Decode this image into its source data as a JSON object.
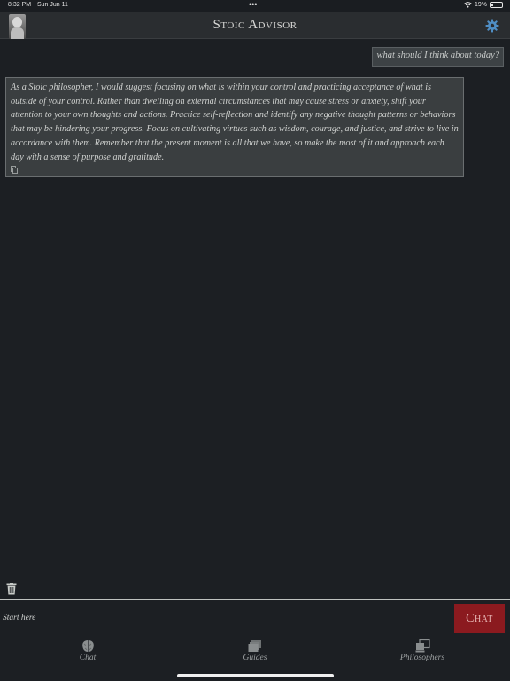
{
  "status_bar": {
    "time": "8:32 PM",
    "date": "Sun Jun 11",
    "dots": "•••",
    "battery_text": "19%",
    "battery_level": 0.19
  },
  "nav": {
    "title": "Stoic Advisor"
  },
  "messages": {
    "user": "what should I think about today?",
    "bot": "As a Stoic philosopher, I would suggest focusing on what is within your control and practicing acceptance of what is outside of your control. Rather than dwelling on external circumstances that may cause stress or anxiety, shift your attention to your own thoughts and actions. Practice self-reflection and identify any negative thought patterns or behaviors that may be hindering your progress. Focus on cultivating virtues such as wisdom, courage, and justice, and strive to live in accordance with them. Remember that the present moment is all that we have, so make the most of it and approach each day with a sense of purpose and gratitude."
  },
  "input": {
    "placeholder": "Start here",
    "value": "",
    "chat_button": "Chat"
  },
  "tabs": [
    {
      "label": "Chat",
      "icon": "brain-icon"
    },
    {
      "label": "Guides",
      "icon": "guides-icon"
    },
    {
      "label": "Philosophers",
      "icon": "philosophers-icon"
    }
  ],
  "colors": {
    "background": "#1c1f23",
    "accent": "#8b1a1f",
    "bubble": "#3a3e40",
    "gear": "#4f8ec4"
  }
}
